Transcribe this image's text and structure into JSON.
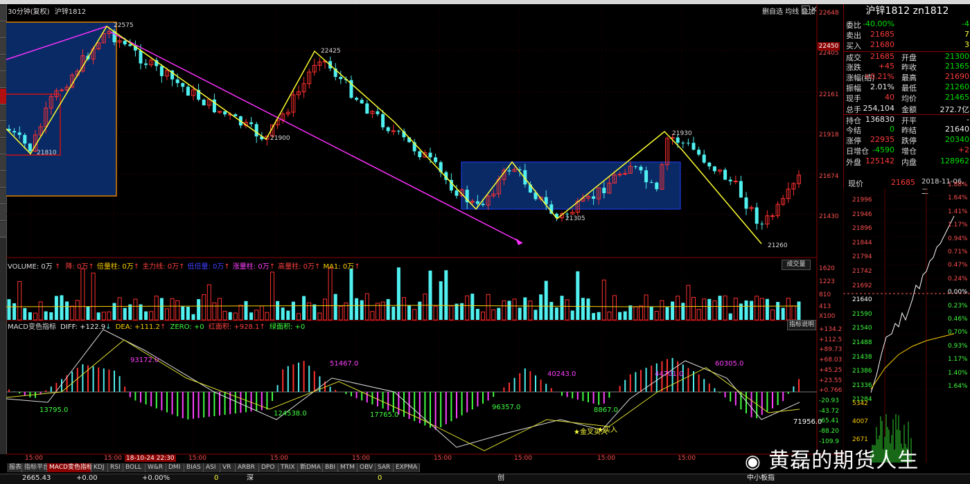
{
  "header": {
    "period_label": "30分钟(复权)",
    "symbol_label": "沪锌1812",
    "top_right_tools": "删自选 均线 叠加"
  },
  "price_axis": [
    "22648",
    "22405",
    "22161",
    "21918",
    "21674",
    "21430"
  ],
  "price_axis_highlight": "22450",
  "price_annotations": [
    {
      "label": "22575"
    },
    {
      "label": "21810"
    },
    {
      "label": "21900"
    },
    {
      "label": "22425"
    },
    {
      "label": "21305"
    },
    {
      "label": "21930"
    },
    {
      "label": "21260"
    }
  ],
  "time_axis": [
    "15:00",
    "15:00",
    "18-10-24 22:30",
    "15:00",
    "15:00",
    "15:00",
    "15:00",
    "15:00",
    "15:00",
    "15:00"
  ],
  "volume": {
    "title": "VOLUME: 0万",
    "items": [
      {
        "label": "降: 0万",
        "color": "#ff4040"
      },
      {
        "label": "倍量柱: 0万",
        "color": "#ffd000"
      },
      {
        "label": "主力线: 0万",
        "color": "#ff4040"
      },
      {
        "label": "低倍量: 0万",
        "color": "#4040ff"
      },
      {
        "label": "涨量柱: 0万",
        "color": "#ff40ff"
      },
      {
        "label": "高量柱: 0万",
        "color": "#ff4040"
      },
      {
        "label": "MA1: 0万",
        "color": "#ffd000"
      }
    ],
    "button": "成交量",
    "axis": [
      "1620",
      "1223",
      "810",
      "413",
      "X100"
    ],
    "bei_label": "倍",
    "gao_label": "高"
  },
  "macd": {
    "title": "MACD变色指标",
    "diff": "DIFF: +122.9",
    "dea": "DEA: +111.2",
    "zero": "ZERO: +0",
    "red_area": "红面积: +928.1",
    "green_area": "绿面积: +0",
    "button": "指标说明",
    "axis": [
      "+134.2",
      "+112.5",
      "+89.73",
      "+68.03",
      "+45.25",
      "+23.55",
      "+0.766",
      "-20.93",
      "-43.72",
      "-65.41",
      "-88.20",
      "-109.9"
    ],
    "value_labels": [
      {
        "label": "13795.0",
        "color": "#40ff40"
      },
      {
        "label": "93172.0",
        "color": "#ff40ff"
      },
      {
        "label": "124538.0",
        "color": "#40ff40"
      },
      {
        "label": "51467.0",
        "color": "#ff40ff"
      },
      {
        "label": "17765.0",
        "color": "#40ff40"
      },
      {
        "label": "96357.0",
        "color": "#40ff40"
      },
      {
        "label": "40243.0",
        "color": "#ff40ff"
      },
      {
        "label": "8867.0",
        "color": "#40ff40"
      },
      {
        "label": "44701.0",
        "color": "#ff40ff"
      },
      {
        "label": "60305.0",
        "color": "#ff40ff"
      },
      {
        "label": "71956.0",
        "color": "#ffffff"
      }
    ],
    "buy_label": "买入",
    "star_buy_label": "金叉买入"
  },
  "quote": {
    "title": "沪锌1812 zn1812",
    "rows": [
      {
        "l1": "委比",
        "v1": "-40.00%",
        "c1": "green",
        "l2": "",
        "v2": "-4",
        "c2": "green"
      },
      {
        "l1": "卖出",
        "v1": "21685",
        "c1": "red",
        "l2": "",
        "v2": "7",
        "c2": "yel"
      },
      {
        "l1": "买入",
        "v1": "21680",
        "c1": "red",
        "l2": "",
        "v2": "3",
        "c2": "yel"
      },
      {
        "l1": "成交",
        "v1": "21685",
        "c1": "red",
        "l2": "开盘",
        "v2": "21300",
        "c2": "green"
      },
      {
        "l1": "涨跌",
        "v1": "+45",
        "c1": "red",
        "l2": "昨收",
        "v2": "21365",
        "c2": "green"
      },
      {
        "l1": "涨幅(结)",
        "v1": "+0.21%",
        "c1": "red",
        "l2": "最高",
        "v2": "21690",
        "c2": "red"
      },
      {
        "l1": "振幅",
        "v1": "2.01%",
        "c1": "white",
        "l2": "最低",
        "v2": "21260",
        "c2": "green"
      },
      {
        "l1": "现手",
        "v1": "40",
        "c1": "red",
        "l2": "均价",
        "v2": "21465",
        "c2": "green"
      },
      {
        "l1": "总手",
        "v1": "254,104",
        "c1": "white",
        "l2": "金额",
        "v2": "272.7亿",
        "c2": "white"
      },
      {
        "l1": "持仓",
        "v1": "136830",
        "c1": "white",
        "l2": "开平",
        "v2": "-",
        "c2": "white"
      },
      {
        "l1": "今结",
        "v1": "0",
        "c1": "green",
        "l2": "昨结",
        "v2": "21640",
        "c2": "white"
      },
      {
        "l1": "涨停",
        "v1": "22935",
        "c1": "red",
        "l2": "跌停",
        "v2": "20340",
        "c2": "green"
      },
      {
        "l1": "日增仓",
        "v1": "-4590",
        "c1": "green",
        "l2": "增仓",
        "v2": "+2",
        "c2": "red"
      },
      {
        "l1": "外盘",
        "v1": "125142",
        "c1": "red",
        "l2": "内盘",
        "v2": "128962",
        "c2": "green"
      }
    ],
    "price_label": "现价",
    "price_value": "21685",
    "date": "2018-11-06,二"
  },
  "intraday": {
    "left_axis": [
      "21996",
      "21946",
      "21896",
      "21844",
      "21794",
      "21742",
      "21692",
      "21640",
      "21590",
      "21540",
      "21488",
      "21438",
      "21386",
      "21336",
      "21284",
      "5342",
      "4007",
      "2671"
    ],
    "right_axis": [
      "1.88%",
      "1.64%",
      "1.41%",
      "1.17%",
      "0.94%",
      "0.71%",
      "0.47%",
      "0.24%",
      "0.00%",
      "0.23%",
      "0.46%",
      "0.70%",
      "0.93%",
      "1.17%",
      "1.40%",
      "1.64%"
    ]
  },
  "tabs": [
    {
      "label": "报表",
      "active": false
    },
    {
      "label": "指标平台",
      "active": false
    },
    {
      "label": "MACD变色指标",
      "active": true
    },
    {
      "label": "KDJ",
      "active": false
    },
    {
      "label": "RSI",
      "active": false
    },
    {
      "label": "BOLL",
      "active": false
    },
    {
      "label": "W&R",
      "active": false
    },
    {
      "label": "DMI",
      "active": false
    },
    {
      "label": "BIAS",
      "active": false
    },
    {
      "label": "ASI",
      "active": false
    },
    {
      "label": "VR",
      "active": false
    },
    {
      "label": "ARBR",
      "active": false
    },
    {
      "label": "DPO",
      "active": false
    },
    {
      "label": "TRIX",
      "active": false
    },
    {
      "label": "新DMA",
      "active": false
    },
    {
      "label": "BBI",
      "active": false
    },
    {
      "label": "MTM",
      "active": false
    },
    {
      "label": "OBV",
      "active": false
    },
    {
      "label": "SAR",
      "active": false
    },
    {
      "label": "EXPMA",
      "active": false
    }
  ],
  "status": {
    "index_value": "2665.43",
    "change1": "+0.00",
    "change2": "+0.00%",
    "zero": "0",
    "shen": "深",
    "chuang": "创",
    "zxb": "中小板指"
  },
  "watermark": "黄磊的期货人生"
}
